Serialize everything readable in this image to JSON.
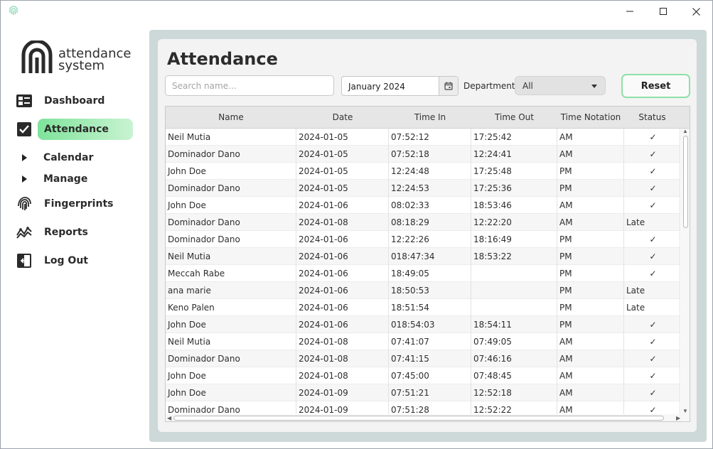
{
  "window": {
    "controls": {
      "minimize": "minimize-icon",
      "maximize": "maximize-icon",
      "close": "close-icon"
    }
  },
  "sidebar": {
    "logo_line1": "attendance",
    "logo_line2": "system",
    "items": [
      {
        "label": "Dashboard",
        "icon": "dashboard-icon"
      },
      {
        "label": "Attendance",
        "icon": "checkbox-icon",
        "active": true
      },
      {
        "label": "Calendar",
        "icon": "chevron-right-icon",
        "expandable": true
      },
      {
        "label": "Manage",
        "icon": "chevron-right-icon",
        "expandable": true
      },
      {
        "label": "Fingerprints",
        "icon": "fingerprint-icon"
      },
      {
        "label": "Reports",
        "icon": "chart-icon"
      },
      {
        "label": "Log Out",
        "icon": "logout-icon"
      }
    ],
    "accent": "#7ee39a"
  },
  "main": {
    "title": "Attendance",
    "search_placeholder": "Search name...",
    "date_value": "January 2024",
    "department_label": "Department",
    "department_value": "All",
    "reset_label": "Reset",
    "columns": [
      "Name",
      "Date",
      "Time In",
      "Time Out",
      "Time Notation",
      "Status"
    ],
    "rows": [
      [
        "Neil Mutia",
        "2024-01-05",
        "07:52:12",
        "17:25:42",
        "AM",
        "✓"
      ],
      [
        "Dominador Dano",
        "2024-01-05",
        "07:52:18",
        "12:24:41",
        "AM",
        "✓"
      ],
      [
        "John Doe",
        "2024-01-05",
        "12:24:48",
        "17:25:48",
        "PM",
        "✓"
      ],
      [
        "Dominador Dano",
        "2024-01-05",
        "12:24:53",
        "17:25:36",
        "PM",
        "✓"
      ],
      [
        "John Doe",
        "2024-01-06",
        "08:02:33",
        "18:53:46",
        "AM",
        "✓"
      ],
      [
        "Dominador Dano",
        "2024-01-08",
        "08:18:29",
        "12:22:20",
        "AM",
        "Late"
      ],
      [
        "Dominador Dano",
        "2024-01-06",
        "12:22:26",
        "18:16:49",
        "PM",
        "✓"
      ],
      [
        "Neil Mutia",
        "2024-01-06",
        "018:47:34",
        "18:53:22",
        "PM",
        "✓"
      ],
      [
        "Meccah Rabe",
        "2024-01-06",
        "18:49:05",
        "",
        "PM",
        "✓"
      ],
      [
        "ana marie",
        "2024-01-06",
        "18:50:53",
        "",
        "PM",
        "Late"
      ],
      [
        "Keno Palen",
        "2024-01-06",
        "18:51:54",
        "",
        "PM",
        "Late"
      ],
      [
        "John Doe",
        "2024-01-06",
        "018:54:03",
        "18:54:11",
        "PM",
        "✓"
      ],
      [
        "Neil Mutia",
        "2024-01-08",
        "07:41:07",
        "07:49:05",
        "AM",
        "✓"
      ],
      [
        "Dominador Dano",
        "2024-01-08",
        "07:41:15",
        "07:46:16",
        "AM",
        "✓"
      ],
      [
        "John Doe",
        "2024-01-08",
        "07:45:00",
        "07:48:45",
        "AM",
        "✓"
      ],
      [
        "John Doe",
        "2024-01-09",
        "07:51:21",
        "12:52:18",
        "AM",
        "✓"
      ],
      [
        "Dominador Dano",
        "2024-01-09",
        "07:51:28",
        "12:52:22",
        "AM",
        "✓"
      ]
    ]
  }
}
